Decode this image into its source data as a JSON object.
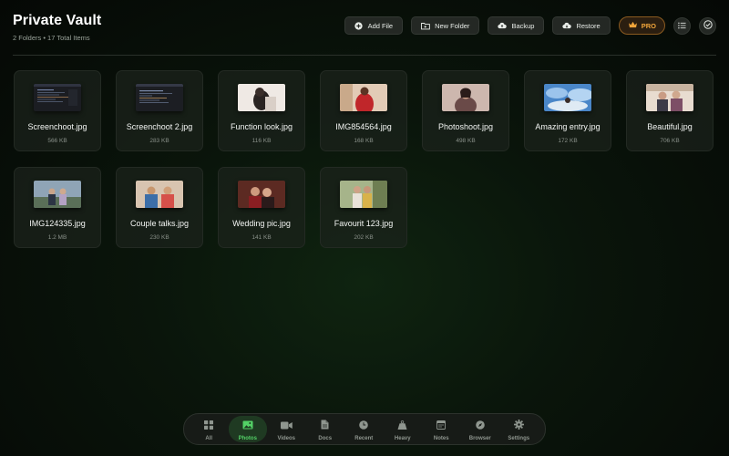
{
  "header": {
    "title": "Private Vault",
    "subtitle": "2 Folders • 17 Total Items"
  },
  "toolbar": {
    "add_file": "Add File",
    "new_folder": "New Folder",
    "backup": "Backup",
    "restore": "Restore",
    "pro": "PRO"
  },
  "colors": {
    "accent": "#53d066",
    "pro": "#f0a43a",
    "background": "#0a150b"
  },
  "files": [
    {
      "name": "Screenchoot.jpg",
      "size": "566 KB",
      "thumb": "screenshot-dark"
    },
    {
      "name": "Screenchoot 2.jpg",
      "size": "283 KB",
      "thumb": "screenshot-dark"
    },
    {
      "name": "Function look.jpg",
      "size": "116 KB",
      "thumb": "photo-light"
    },
    {
      "name": "IMG854564.jpg",
      "size": "168 KB",
      "thumb": "photo-red"
    },
    {
      "name": "Photoshoot.jpg",
      "size": "498 KB",
      "thumb": "photo-warm"
    },
    {
      "name": "Amazing entry.jpg",
      "size": "172 KB",
      "thumb": "photo-blue"
    },
    {
      "name": "Beautiful.jpg",
      "size": "706 KB",
      "thumb": "photo-couple"
    },
    {
      "name": "IMG124335.jpg",
      "size": "1.2 MB",
      "thumb": "photo-outdoor"
    },
    {
      "name": "Couple talks.jpg",
      "size": "230 KB",
      "thumb": "photo-couple"
    },
    {
      "name": "Wedding pic.jpg",
      "size": "141 KB",
      "thumb": "photo-red"
    },
    {
      "name": "Favourit 123.jpg",
      "size": "202 KB",
      "thumb": "photo-outdoor"
    }
  ],
  "tabs": [
    {
      "label": "All",
      "icon": "grid-icon"
    },
    {
      "label": "Photos",
      "icon": "photo-icon",
      "active": true
    },
    {
      "label": "Videos",
      "icon": "video-icon"
    },
    {
      "label": "Docs",
      "icon": "document-icon"
    },
    {
      "label": "Recent",
      "icon": "clock-icon"
    },
    {
      "label": "Heavy",
      "icon": "weight-icon"
    },
    {
      "label": "Notes",
      "icon": "notes-icon"
    },
    {
      "label": "Browser",
      "icon": "compass-icon"
    },
    {
      "label": "Settings",
      "icon": "gear-icon"
    }
  ]
}
